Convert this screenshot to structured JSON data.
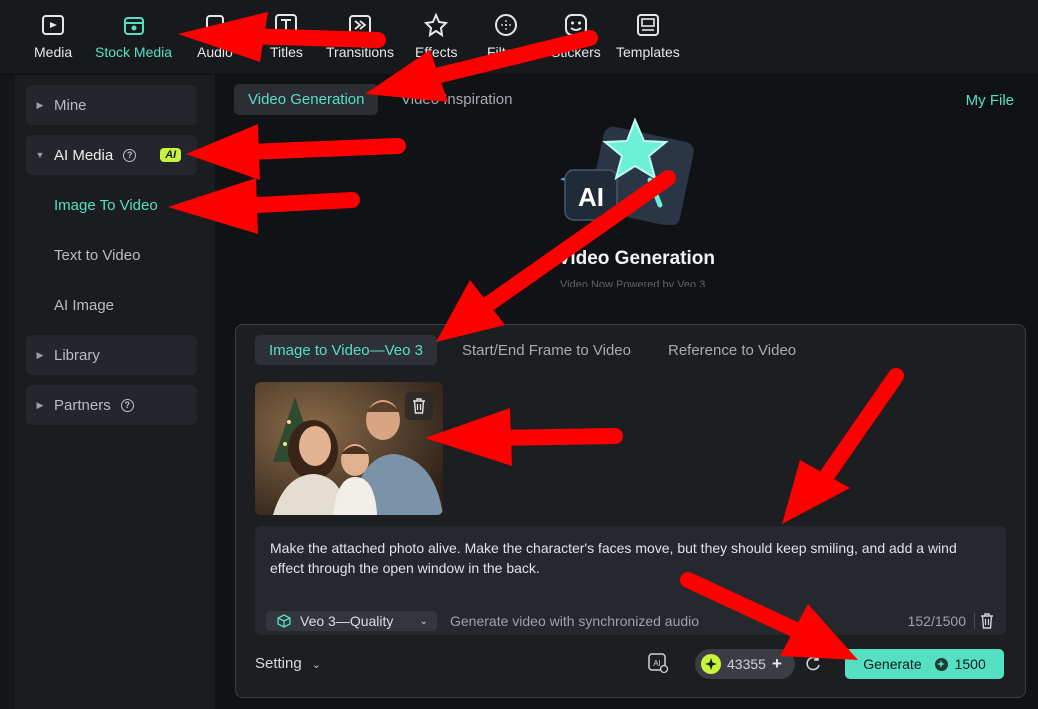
{
  "toolbar": {
    "items": [
      {
        "label": "Media",
        "icon": "media-icon"
      },
      {
        "label": "Stock Media",
        "icon": "stock-media-icon",
        "active": true
      },
      {
        "label": "Audio",
        "icon": "audio-icon"
      },
      {
        "label": "Titles",
        "icon": "titles-icon"
      },
      {
        "label": "Transitions",
        "icon": "transitions-icon"
      },
      {
        "label": "Effects",
        "icon": "effects-icon"
      },
      {
        "label": "Filters",
        "icon": "filters-icon"
      },
      {
        "label": "Stickers",
        "icon": "stickers-icon"
      },
      {
        "label": "Templates",
        "icon": "templates-icon"
      }
    ]
  },
  "sidebar": {
    "mine": "Mine",
    "ai_media": "AI Media",
    "ai_badge": "AI",
    "image_to_video": "Image To Video",
    "text_to_video": "Text to Video",
    "ai_image": "AI Image",
    "library": "Library",
    "partners": "Partners"
  },
  "main": {
    "tabs": [
      "Video Generation",
      "Video Inspiration"
    ],
    "my_file": "My File",
    "hero_title": "Video Generation",
    "hero_icon_text": "AI",
    "hero_subtitle": "Video Now Powered by Veo 3"
  },
  "panel": {
    "tabs": [
      "Image to Video—Veo 3",
      "Start/End Frame to Video",
      "Reference to Video"
    ],
    "prompt": "Make the attached photo alive. Make the character's faces move, but they should keep smiling, and add a wind effect through the open window in the back.",
    "model": "Veo 3—Quality",
    "model_desc": "Generate video with synchronized audio",
    "counter": "152/1500",
    "setting": "Setting",
    "credits": "43355",
    "generate": "Generate",
    "cost": "1500"
  },
  "colors": {
    "accent": "#56e0c3",
    "ai_badge": "#c7f53b",
    "annotation_arrow": "#ff0000"
  }
}
